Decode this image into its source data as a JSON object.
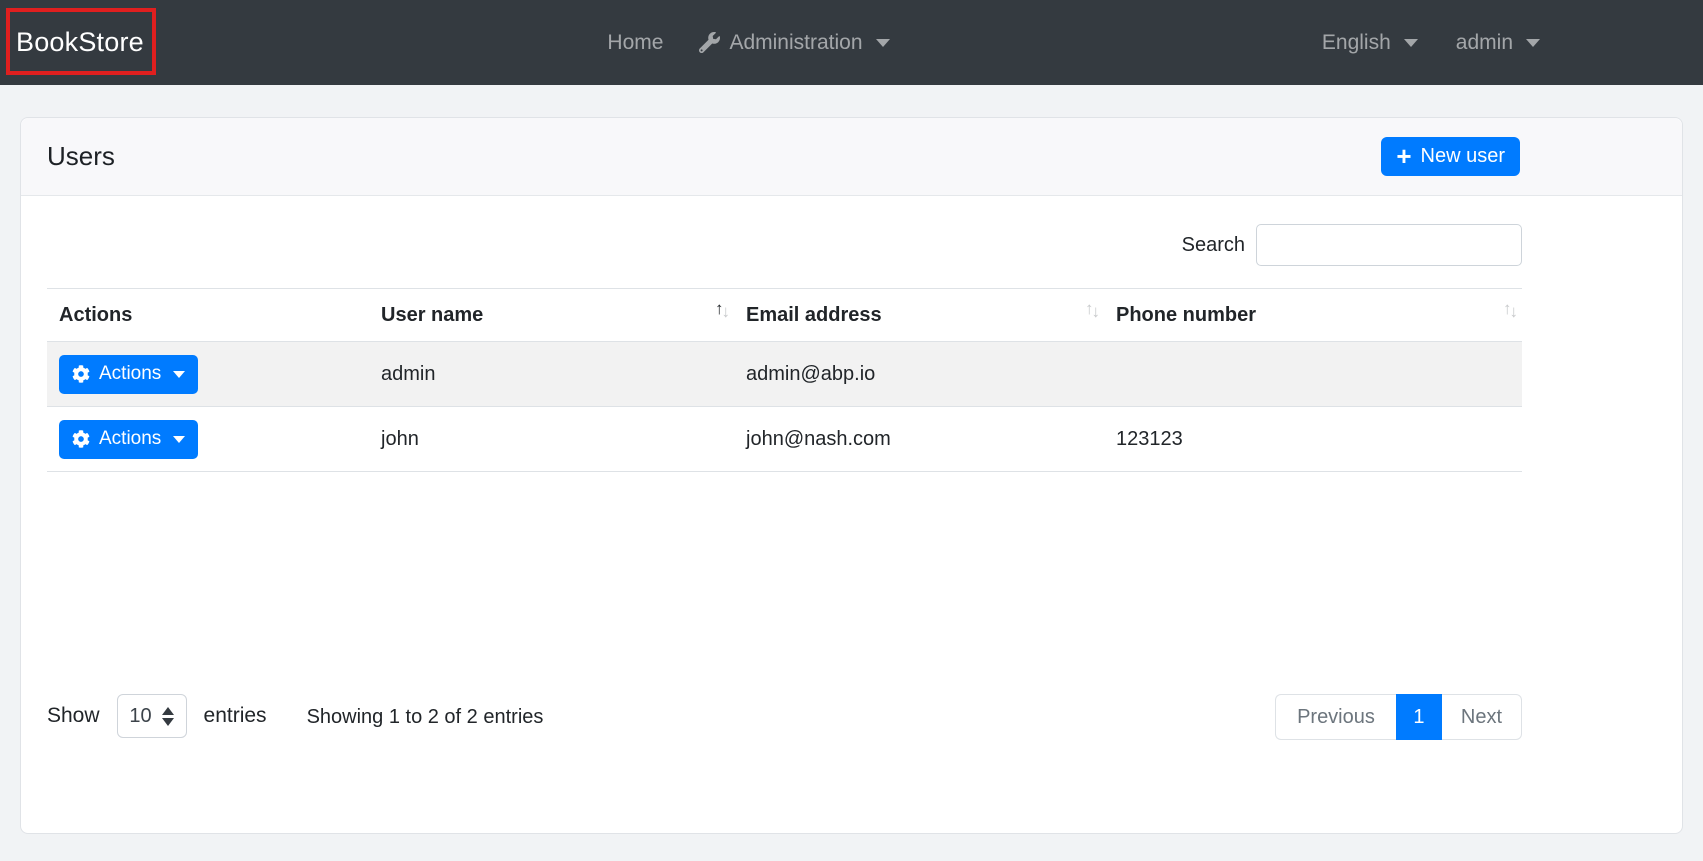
{
  "navbar": {
    "brand": "BookStore",
    "home_label": "Home",
    "administration_label": "Administration",
    "language_label": "English",
    "user_label": "admin"
  },
  "page": {
    "title": "Users",
    "new_user_label": "New user",
    "search_label": "Search",
    "search_value": ""
  },
  "table": {
    "columns": [
      {
        "label": "Actions",
        "sortable": false,
        "sort": "none"
      },
      {
        "label": "User name",
        "sortable": true,
        "sort": "asc"
      },
      {
        "label": "Email address",
        "sortable": true,
        "sort": "none"
      },
      {
        "label": "Phone number",
        "sortable": true,
        "sort": "none"
      }
    ],
    "action_button_label": "Actions",
    "rows": [
      {
        "user_name": "admin",
        "email": "admin@abp.io",
        "phone": ""
      },
      {
        "user_name": "john",
        "email": "john@nash.com",
        "phone": "123123"
      }
    ]
  },
  "footer": {
    "show_label": "Show",
    "page_size": "10",
    "entries_label": "entries",
    "info": "Showing 1 to 2 of 2 entries",
    "pagination": {
      "previous": "Previous",
      "current": "1",
      "next": "Next"
    }
  },
  "icons": {
    "plus": "+",
    "sort_up": "↑",
    "sort_down": "↓"
  },
  "colors": {
    "primary": "#007bff",
    "navbar_bg": "#343a40",
    "annotation_red": "#e01f1f",
    "striped_row": "#f2f2f2",
    "page_bg": "#f1f3f5",
    "card_header_bg": "#f8f8fa",
    "muted_text": "#6c757d"
  }
}
